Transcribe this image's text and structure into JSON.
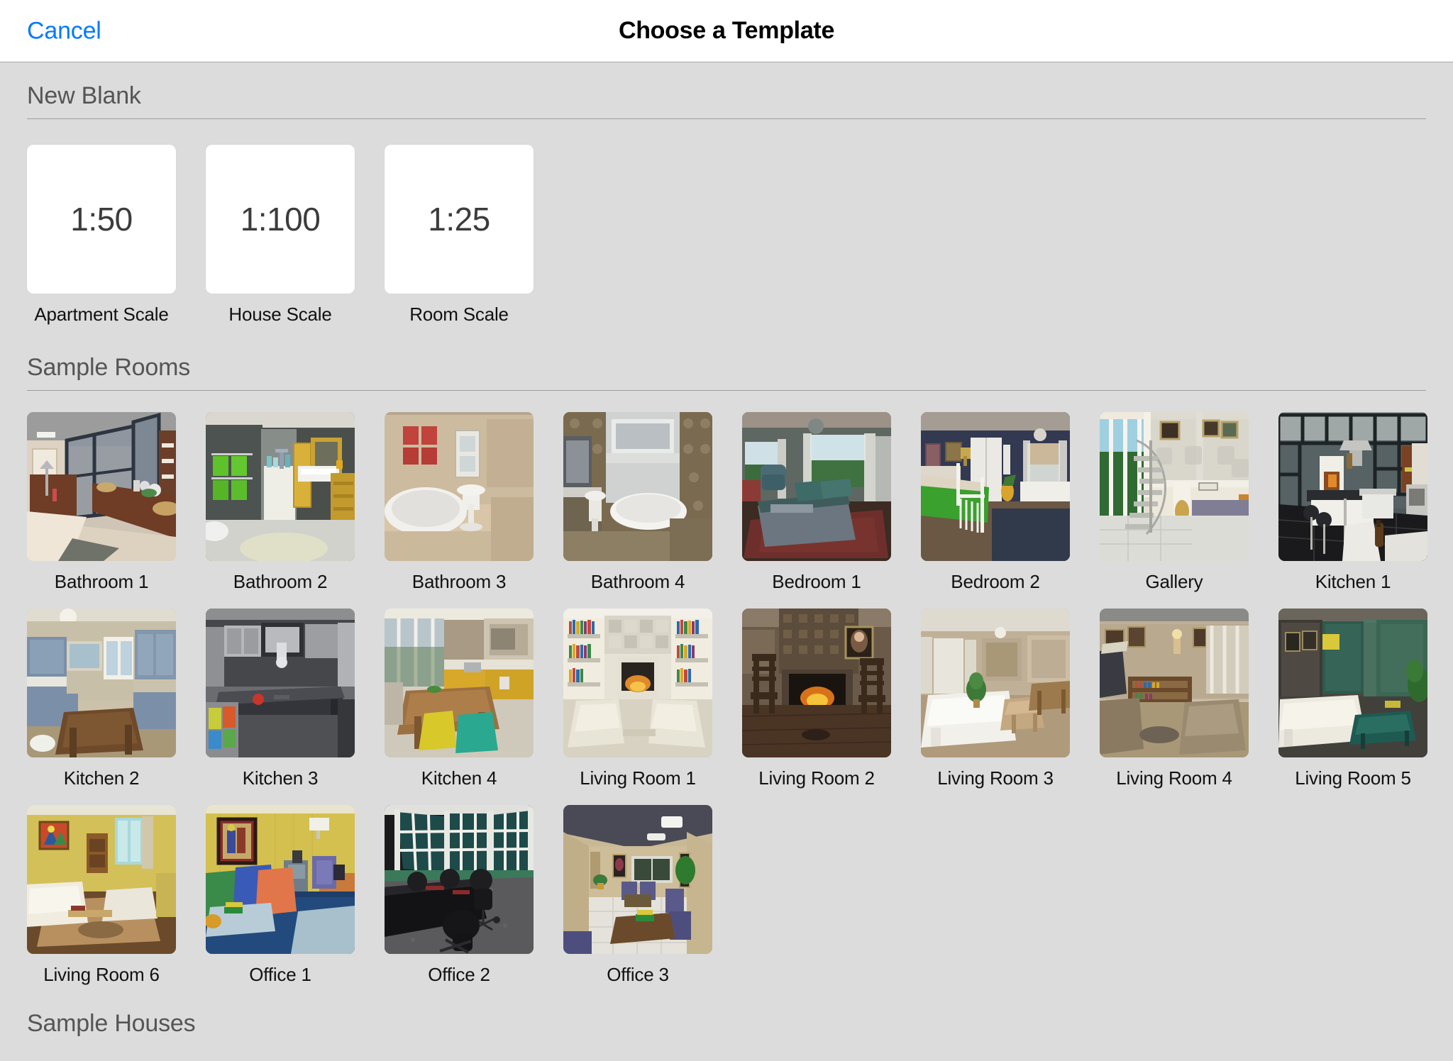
{
  "navbar": {
    "cancel_label": "Cancel",
    "title": "Choose a Template"
  },
  "sections": {
    "new_blank": {
      "header": "New Blank",
      "items": [
        {
          "scale": "1:50",
          "label": "Apartment Scale"
        },
        {
          "scale": "1:100",
          "label": "House Scale"
        },
        {
          "scale": "1:25",
          "label": "Room Scale"
        }
      ]
    },
    "sample_rooms": {
      "header": "Sample Rooms",
      "items": [
        {
          "label": "Bathroom 1"
        },
        {
          "label": "Bathroom 2"
        },
        {
          "label": "Bathroom 3"
        },
        {
          "label": "Bathroom 4"
        },
        {
          "label": "Bedroom 1"
        },
        {
          "label": "Bedroom 2"
        },
        {
          "label": "Gallery"
        },
        {
          "label": "Kitchen 1"
        },
        {
          "label": "Kitchen 2"
        },
        {
          "label": "Kitchen 3"
        },
        {
          "label": "Kitchen 4"
        },
        {
          "label": "Living Room 1"
        },
        {
          "label": "Living Room 2"
        },
        {
          "label": "Living Room 3"
        },
        {
          "label": "Living Room 4"
        },
        {
          "label": "Living Room 5"
        },
        {
          "label": "Living Room 6"
        },
        {
          "label": "Office 1"
        },
        {
          "label": "Office 2"
        },
        {
          "label": "Office 3"
        }
      ]
    },
    "sample_houses": {
      "header": "Sample Houses"
    }
  },
  "colors": {
    "accent": "#007aff",
    "page_background": "#dcdcdc",
    "navbar_background": "#ffffff",
    "card_background": "#ffffff",
    "section_header_text": "#555555",
    "label_text": "#111111",
    "separator": "#9d9d9d"
  }
}
